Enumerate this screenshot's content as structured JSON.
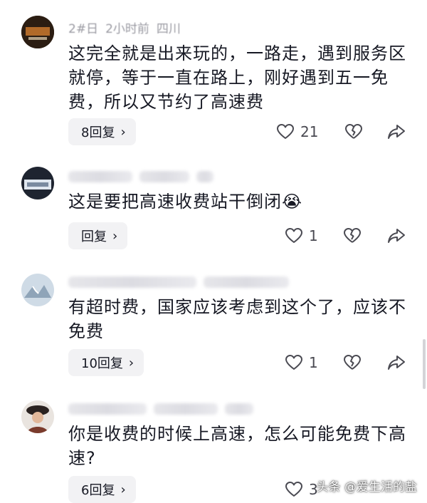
{
  "comments": [
    {
      "meta": [
        "2#日",
        "2小时前",
        "四川"
      ],
      "text": "这完全就是出来玩的，一路走，遇到服务区就停，等于一直在路上，刚好遇到五一免费，所以又节约了高速费",
      "reply_label": "8回复",
      "likes": "21",
      "likes_color": "#4a4a52"
    },
    {
      "meta": [],
      "text": "这是要把高速收费站干倒闭",
      "emoji": "😭",
      "reply_label": "回复",
      "likes": "1"
    },
    {
      "meta": [],
      "text": "有超时费，国家应该考虑到这个了，应该不免费",
      "reply_label": "10回复",
      "likes": "1"
    },
    {
      "meta": [],
      "text": "你是收费的时候上高速，怎么可能免费下高速?",
      "reply_label": "6回复",
      "likes": "3"
    }
  ],
  "icons": {
    "like": "heart-outline-icon",
    "dislike": "broken-heart-icon",
    "share": "share-arrow-icon",
    "chevron": "chevron-right-icon"
  },
  "watermark": "头条 @爱生活的盐",
  "colors": {
    "text": "#161823",
    "muted": "#a8a8ae",
    "button_bg": "#f2f2f4",
    "icon": "#4a4a52"
  }
}
